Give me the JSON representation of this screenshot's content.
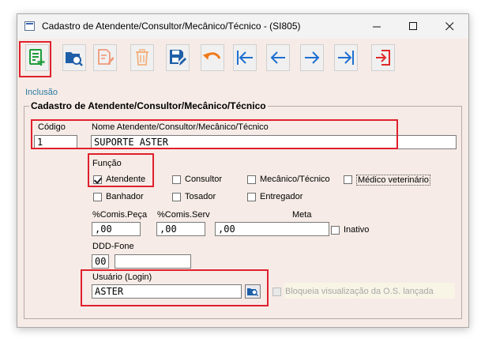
{
  "window": {
    "title": "Cadastro de Atendente/Consultor/Mecânico/Técnico - (SI805)",
    "minimize_glyph": "—",
    "maximize_glyph": "☐",
    "close_glyph": "✕"
  },
  "toolbar": {
    "buttons": [
      {
        "name": "new-record-button",
        "icon": "document-add-icon",
        "color": "#1e9e3a"
      },
      {
        "name": "search-button",
        "icon": "folder-search-icon",
        "color": "#1f5fa8"
      },
      {
        "name": "edit-button",
        "icon": "document-edit-icon",
        "color": "#f09a7a"
      },
      {
        "name": "delete-button",
        "icon": "trash-icon",
        "color": "#f4b07c"
      },
      {
        "name": "save-button",
        "icon": "save-edit-icon",
        "color": "#1f5fa8"
      },
      {
        "name": "undo-button",
        "icon": "undo-icon",
        "color": "#f07a1a"
      },
      {
        "name": "first-record-button",
        "icon": "arrow-first-icon",
        "color": "#1f6fd0"
      },
      {
        "name": "previous-record-button",
        "icon": "arrow-left-icon",
        "color": "#1f6fd0"
      },
      {
        "name": "next-record-button",
        "icon": "arrow-right-icon",
        "color": "#1f6fd0"
      },
      {
        "name": "last-record-button",
        "icon": "arrow-last-icon",
        "color": "#1f6fd0"
      },
      {
        "name": "exit-button",
        "icon": "exit-icon",
        "color": "#e02a2a"
      }
    ]
  },
  "mode_label": "Inclusão",
  "form": {
    "group_title": "Cadastro de Atendente/Consultor/Mecânico/Técnico",
    "codigo_label": "Código",
    "codigo_value": "1",
    "nome_label": "Nome Atendente/Consultor/Mecânico/Técnico",
    "nome_value": "SUPORTE ASTER",
    "funcao_label": "Função",
    "funcoes": {
      "atendente": {
        "label": "Atendente",
        "checked": true
      },
      "consultor": {
        "label": "Consultor",
        "checked": false
      },
      "mecanico": {
        "label": "Mecânico/Técnico",
        "checked": false
      },
      "medico": {
        "label": "Médico veterinário",
        "checked": false
      },
      "banhador": {
        "label": "Banhador",
        "checked": false
      },
      "tosador": {
        "label": "Tosador",
        "checked": false
      },
      "entregador": {
        "label": "Entregador",
        "checked": false
      }
    },
    "comis_peca_label": "%Comis.Peça",
    "comis_peca_value": ",00",
    "comis_serv_label": "%Comis.Serv",
    "comis_serv_value": ",00",
    "meta_label": "Meta",
    "meta_value": ",00",
    "inativo_label": "Inativo",
    "ddd_fone_label": "DDD-Fone",
    "ddd_value": "00",
    "fone_value": "",
    "usuario_label": "Usuário (Login)",
    "usuario_value": "ASTER",
    "bloqueia_label": "Bloqueia visualização da O.S. lançada"
  }
}
